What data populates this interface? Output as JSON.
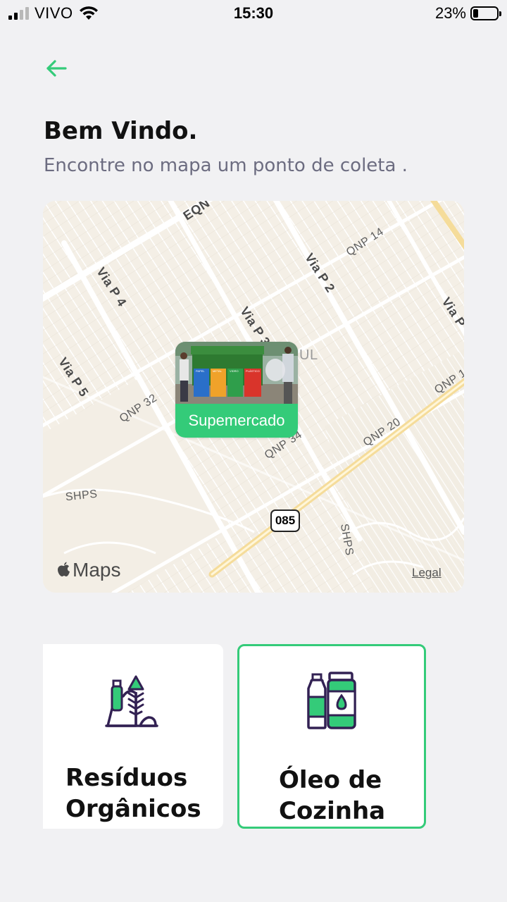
{
  "status_bar": {
    "carrier": "VIVO",
    "time": "15:30",
    "battery_percent": "23%",
    "battery_level": 0.23,
    "signal_bars": 2
  },
  "header": {
    "back_icon": "arrow-left-icon",
    "title": "Bem Vindo.",
    "subtitle": "Encontre no mapa um ponto de coleta ."
  },
  "map": {
    "labels": {
      "eqn": "EQN",
      "via_p4": "Via P 4",
      "via_p2": "Via P 2",
      "via_p3": "Via P 3",
      "via_p5": "Via P 5",
      "via_p_right": "Via P",
      "qnp14": "QNP 14",
      "qnp32": "QNP 32",
      "qnp34": "QNP 34",
      "qnp20": "QNP 20",
      "qnp1": "QNP 1",
      "shps_left": "SHPS",
      "shps_bottom": "SHPS",
      "ul": "UL"
    },
    "route_shield": "085",
    "maps_brand": "Maps",
    "legal": "Legal",
    "marker": {
      "label": "Supemercado",
      "bin_labels": [
        "PAPEL",
        "METAL",
        "VIDRO",
        "PLÁSTICO"
      ]
    }
  },
  "categories": [
    {
      "name": "Resíduos\nOrgânicos",
      "icon": "organic-waste-icon",
      "selected": false
    },
    {
      "name": "Óleo de\nCozinha",
      "icon": "cooking-oil-icon",
      "selected": true
    }
  ],
  "colors": {
    "accent": "#34cb79",
    "icon_dark": "#322153",
    "title": "#111111",
    "subtitle": "#6c6c80",
    "background": "#f1f1f3"
  }
}
